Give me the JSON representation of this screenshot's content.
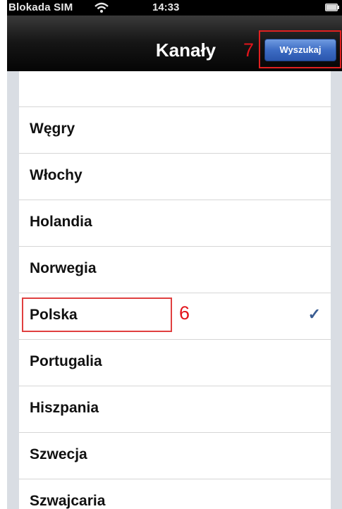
{
  "status_bar": {
    "carrier": "Blokada SIM",
    "time": "14:33"
  },
  "nav": {
    "title": "Kanały",
    "search_label": "Wyszukaj"
  },
  "annotations": {
    "search": "7",
    "selected_row": "6"
  },
  "list": {
    "items": [
      {
        "label": "Węgry"
      },
      {
        "label": "Włochy"
      },
      {
        "label": "Holandia"
      },
      {
        "label": "Norwegia"
      },
      {
        "label": "Polska",
        "checkmark": "✓"
      },
      {
        "label": "Portugalia"
      },
      {
        "label": "Hiszpania"
      },
      {
        "label": "Szwecja"
      },
      {
        "label": "Szwajcaria"
      }
    ]
  },
  "colors": {
    "annotation_red": "#e3141b",
    "checkmark_blue": "#3a5d93",
    "search_button_blue": "#3d6cc4"
  },
  "icons": [
    "wifi-icon",
    "battery-icon",
    "checkmark-icon"
  ]
}
